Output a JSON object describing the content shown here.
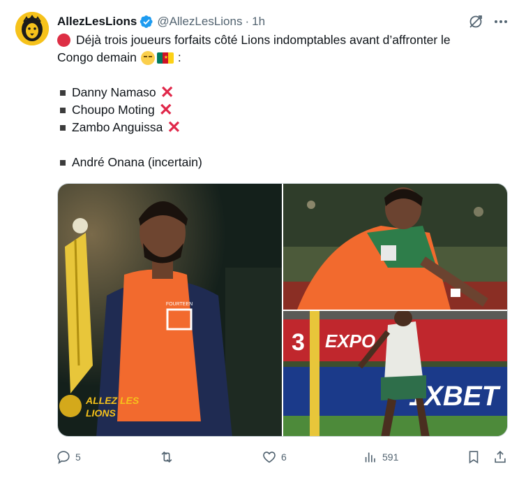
{
  "author": {
    "display_name": "AllezLesLions",
    "handle": "@AllezLesLions",
    "separator": "·",
    "time": "1h"
  },
  "tweet": {
    "line1": "Déjà trois joueurs forfaits côté Lions indomptables avant d’affronter le",
    "line2_text": "Congo demain",
    "line2_suffix": ":",
    "players_out": [
      {
        "name": "Danny Namaso"
      },
      {
        "name": "Choupo Moting"
      },
      {
        "name": "Zambo Anguissa"
      }
    ],
    "player_uncertain": "André Onana (incertain)",
    "cross_mark": "✕"
  },
  "media": {
    "watermark_line1": "ALLEZ LES",
    "watermark_line2": "LIONS",
    "bib_brand": "FOURTEEN",
    "board_text_1": "3",
    "board_text_2": "EXPO",
    "board_text_3": "1XBET"
  },
  "stats": {
    "replies": "5",
    "retweets": "",
    "likes": "6",
    "views": "591"
  },
  "colors": {
    "accent": "#1d9bf0",
    "text_secondary": "#536471",
    "cross_red": "#e0284a",
    "bib_orange": "#f26a2e"
  },
  "icons": [
    "verified-badge-icon",
    "grok-icon",
    "more-icon",
    "reply-icon",
    "retweet-icon",
    "like-icon",
    "views-icon",
    "bookmark-icon",
    "share-icon"
  ]
}
